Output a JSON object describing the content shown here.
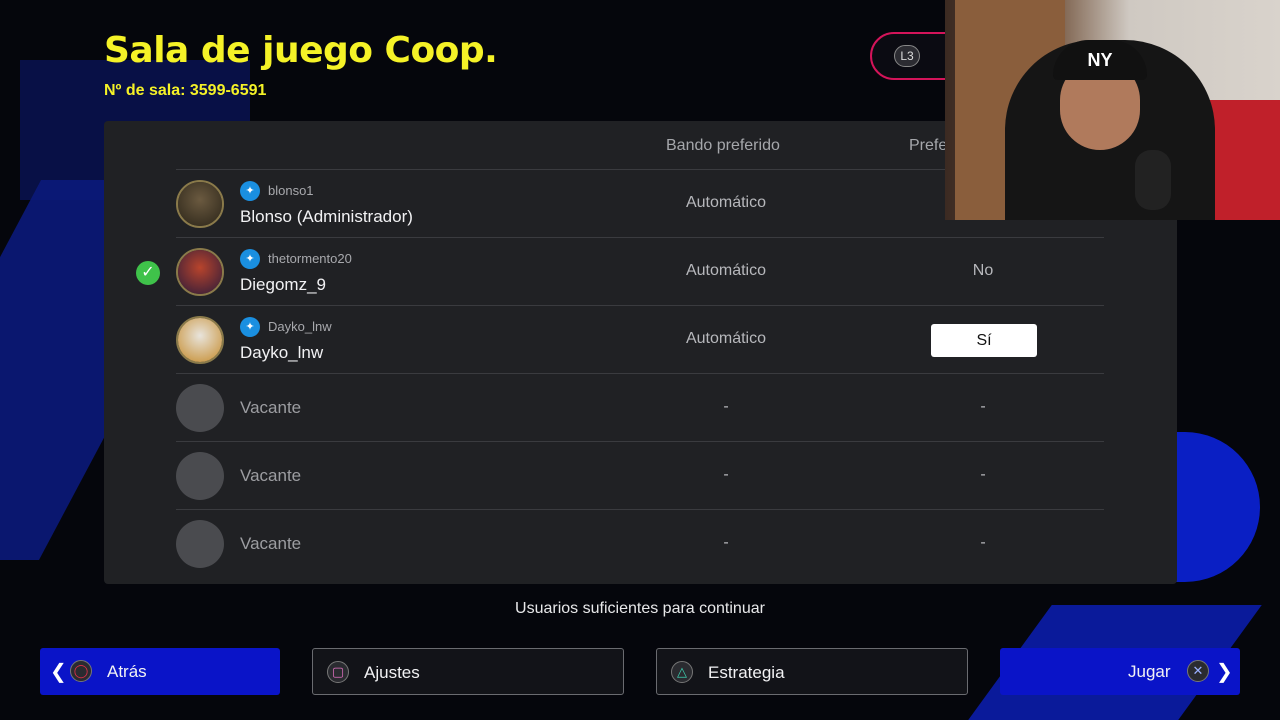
{
  "title": "Sala de juego Coop.",
  "room_number": "Nº de sala: 3599-6591",
  "l3_badge": "L3",
  "columns": {
    "bando": "Bando preferido",
    "pref": "Prefe"
  },
  "players": [
    {
      "psn_id": "blonso1",
      "name": "Blonso (Administrador)",
      "bando": "Automático",
      "pref": "",
      "ready": false
    },
    {
      "psn_id": "thetormento20",
      "name": "Diegomz_9",
      "bando": "Automático",
      "pref": "No",
      "ready": true
    },
    {
      "psn_id": "Dayko_lnw",
      "name": "Dayko_lnw",
      "bando": "Automático",
      "pref": "Sí",
      "ready": false
    }
  ],
  "vacant_rows": [
    {
      "label": "Vacante",
      "bando": "-",
      "pref": "-"
    },
    {
      "label": "Vacante",
      "bando": "-",
      "pref": "-"
    },
    {
      "label": "Vacante",
      "bando": "-",
      "pref": "-"
    }
  ],
  "status": "Usuarios suficientes para continuar",
  "buttons": {
    "back": "Atrás",
    "settings": "Ajustes",
    "strategy": "Estrategia",
    "play": "Jugar"
  },
  "webcam": {
    "cap_logo": "NY"
  },
  "colors": {
    "title": "#f5f227",
    "accent_blue": "#0a14c8",
    "ready_green": "#3fc24a",
    "l3_border": "#d4145a"
  }
}
